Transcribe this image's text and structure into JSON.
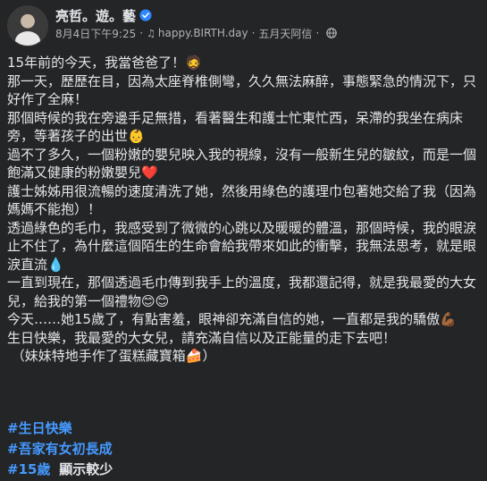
{
  "author": {
    "name": "亮哲。遊。藝",
    "avatar_icon": "profile-photo"
  },
  "meta": {
    "timestamp": "8月4日下午9:25",
    "separator": "·",
    "music_icon": "♫",
    "activity": "happy.BIRTH.day",
    "location": "五月天阿信",
    "privacy_icon": "globe-icon"
  },
  "post_lines": [
    "15年前的今天，我當爸爸了！🧔",
    "那一天，歷歷在目，因為太座脊椎側彎，久久無法麻醉，事態緊急的情況下，只好作了全麻！",
    "那個時候的我在旁邊手足無措，看著醫生和護士忙東忙西，呆滯的我坐在病床旁，等著孩子的出世👶",
    "過不了多久，一個粉嫩的嬰兒映入我的視線，沒有一般新生兒的皺紋，而是一個飽滿又健康的粉嫩嬰兒❤️",
    "護士姊姊用很流暢的速度清洗了她，然後用綠色的護理巾包著她交給了我（因為媽媽不能抱）！",
    "透過綠色的毛巾，我感受到了微微的心跳以及暖暖的體溫，那個時候，我的眼淚止不住了，為什麼這個陌生的生命會給我帶來如此的衝擊，我無法思考，就是眼淚直流💧",
    "一直到現在，那個透過毛巾傳到我手上的溫度，我都還記得，就是我最愛的大女兒，給我的第一個禮物😊😊",
    "今天……她15歲了，有點害羞，眼神卻充滿自信的她，一直都是我的驕傲💪🏾",
    "生日快樂，我最愛的大女兒，請充滿自信以及正能量的走下去吧！",
    " （妹妹特地手作了蛋糕藏寶箱🍰）"
  ],
  "hashtags": [
    "#生日快樂",
    "#吾家有女初長成",
    "#15歲"
  ],
  "show_less": "顯示較少",
  "colors": {
    "background": "#242526",
    "text": "#e4e6eb",
    "secondary": "#b0b3b8",
    "hashtag": "#4599ff",
    "verified": "#2d88ff"
  }
}
